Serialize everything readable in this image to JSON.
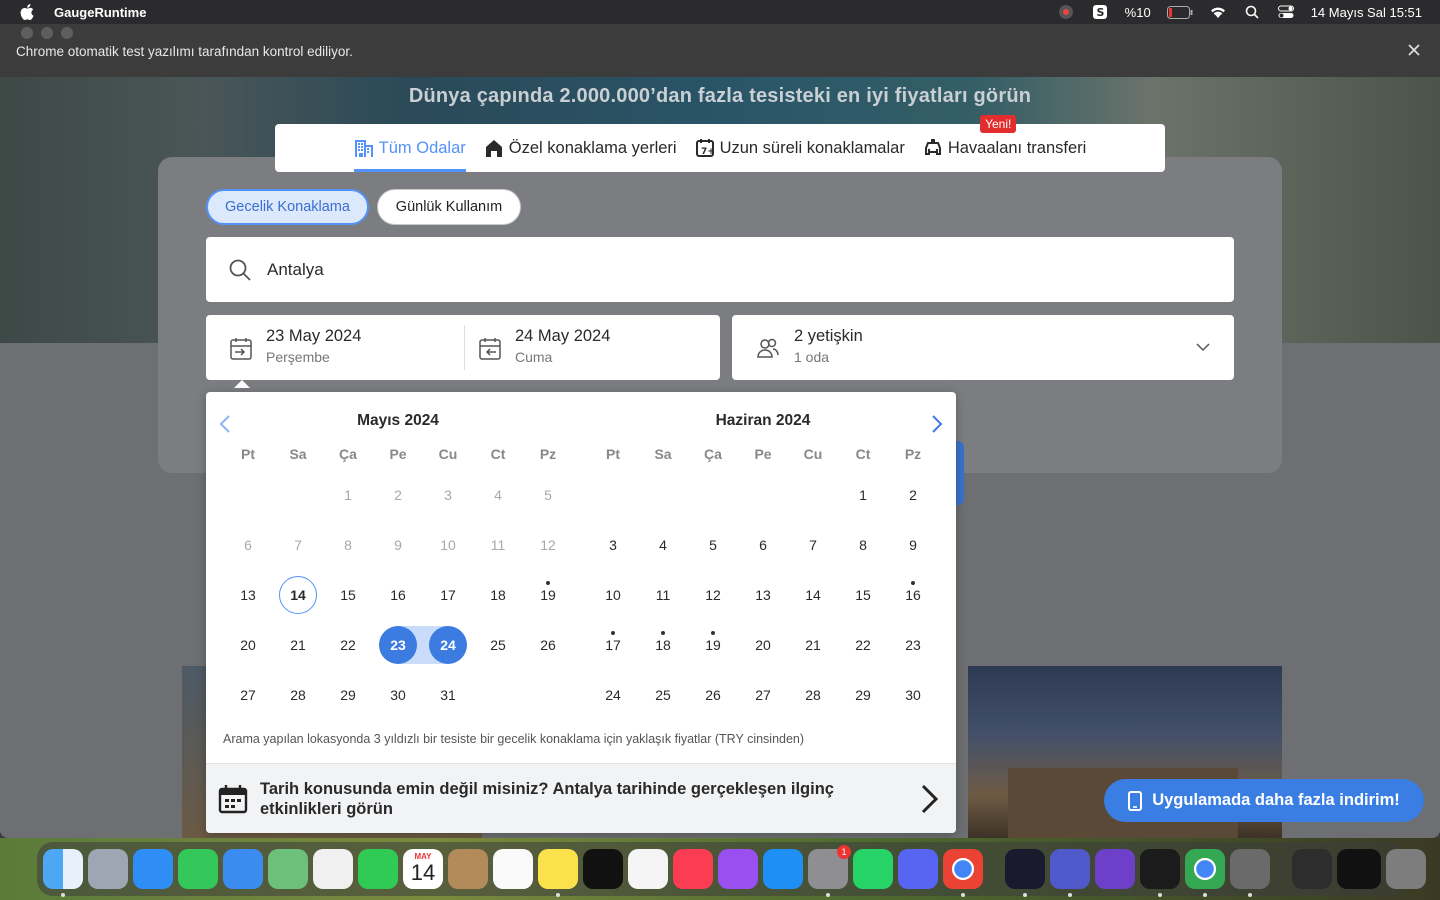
{
  "menubar": {
    "app_name": "GaugeRuntime",
    "battery": "%10",
    "datetime": "14 Mayıs Sal  15:51"
  },
  "infobar": {
    "message": "Chrome otomatik test yazılımı tarafından kontrol ediliyor."
  },
  "hero": {
    "headline": "Dünya çapında 2.000.000’dan fazla tesisteki en iyi fiyatları görün"
  },
  "tabs": [
    {
      "label": "Tüm Odalar",
      "icon": "building-icon",
      "active": true
    },
    {
      "label": "Özel konaklama yerleri",
      "icon": "house-icon",
      "active": false
    },
    {
      "label": "Uzun süreli konaklamalar",
      "icon": "calendar-7-icon",
      "active": false
    },
    {
      "label": "Havaalanı transferi",
      "icon": "car-icon",
      "active": false,
      "badge": "Yeni!"
    }
  ],
  "stay_type": {
    "overnight": "Gecelik Konaklama",
    "day_use": "Günlük Kullanım"
  },
  "search": {
    "value": "Antalya"
  },
  "dates": {
    "checkin_date": "23 May 2024",
    "checkin_day": "Perşembe",
    "checkout_date": "24 May 2024",
    "checkout_day": "Cuma"
  },
  "guests": {
    "adults": "2 yetişkin",
    "rooms": "1 oda"
  },
  "calendar": {
    "weekdays": [
      "Pt",
      "Sa",
      "Ça",
      "Pe",
      "Cu",
      "Ct",
      "Pz"
    ],
    "months": [
      {
        "title": "Mayıs 2024",
        "weeks": [
          [
            "",
            "",
            "1",
            "2",
            "3",
            "4",
            "5"
          ],
          [
            "6",
            "7",
            "8",
            "9",
            "10",
            "11",
            "12"
          ],
          [
            "13",
            "14",
            "15",
            "16",
            "17",
            "18",
            "19"
          ],
          [
            "20",
            "21",
            "22",
            "23",
            "24",
            "25",
            "26"
          ],
          [
            "27",
            "28",
            "29",
            "30",
            "31",
            "",
            ""
          ]
        ]
      },
      {
        "title": "Haziran 2024",
        "weeks": [
          [
            "",
            "",
            "",
            "",
            "",
            "1",
            "2"
          ],
          [
            "3",
            "4",
            "5",
            "6",
            "7",
            "8",
            "9"
          ],
          [
            "10",
            "11",
            "12",
            "13",
            "14",
            "15",
            "16"
          ],
          [
            "17",
            "18",
            "19",
            "20",
            "21",
            "22",
            "23"
          ],
          [
            "24",
            "25",
            "26",
            "27",
            "28",
            "29",
            "30"
          ]
        ]
      }
    ],
    "note": "Arama yapılan lokasyonda 3 yıldızlı bir tesiste bir gecelik konaklama için yaklaşık fiyatlar (TRY cinsinden)",
    "footer_text": "Tarih konusunda emin değil misiniz? Antalya tarihinde gerçekleşen ilginç etkinlikleri görün"
  },
  "app_promo": "Uygulamada daha fazla indirim!",
  "dock": {
    "calendar_month": "MAY",
    "calendar_day": "14",
    "settings_badge": "1"
  }
}
